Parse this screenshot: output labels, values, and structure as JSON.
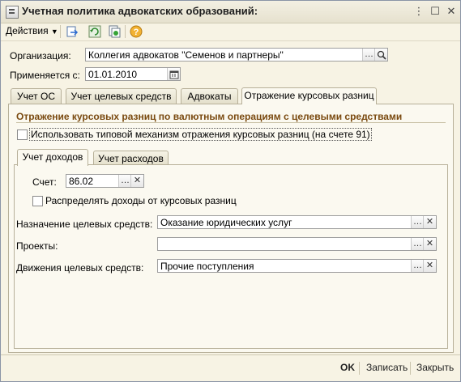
{
  "window": {
    "title": "Учетная политика адвокатских образований:"
  },
  "toolbar": {
    "actions_label": "Действия"
  },
  "form": {
    "org_label": "Организация:",
    "org_value": "Коллегия адвокатов \"Семенов и партнеры\"",
    "applies_label": "Применяется с:",
    "applies_value": "01.01.2010"
  },
  "tabs": [
    {
      "label": "Учет ОС"
    },
    {
      "label": "Учет целевых средств"
    },
    {
      "label": "Адвокаты"
    },
    {
      "label": "Отражение курсовых разниц"
    }
  ],
  "tab_content": {
    "section_title": "Отражение курсовых разниц по валютным операциям с целевыми средствами",
    "use_standard_label": "Использовать типовой механизм отражения курсовых разниц (на счете 91)",
    "inner_tabs": [
      {
        "label": "Учет доходов"
      },
      {
        "label": "Учет расходов"
      }
    ],
    "account_label": "Счет:",
    "account_value": "86.02",
    "distribute_label": "Распределять доходы от курсовых разниц",
    "purpose_label": "Назначение целевых средств:",
    "purpose_value": "Оказание юридических услуг",
    "projects_label": "Проекты:",
    "projects_value": "",
    "movements_label": "Движения целевых средств:",
    "movements_value": "Прочие поступления"
  },
  "bottom": {
    "ok_label": "OK",
    "save_label": "Записать",
    "close_label": "Закрыть"
  },
  "colors": {
    "background": "#f7f3e4",
    "section_title": "#7a4a10"
  }
}
